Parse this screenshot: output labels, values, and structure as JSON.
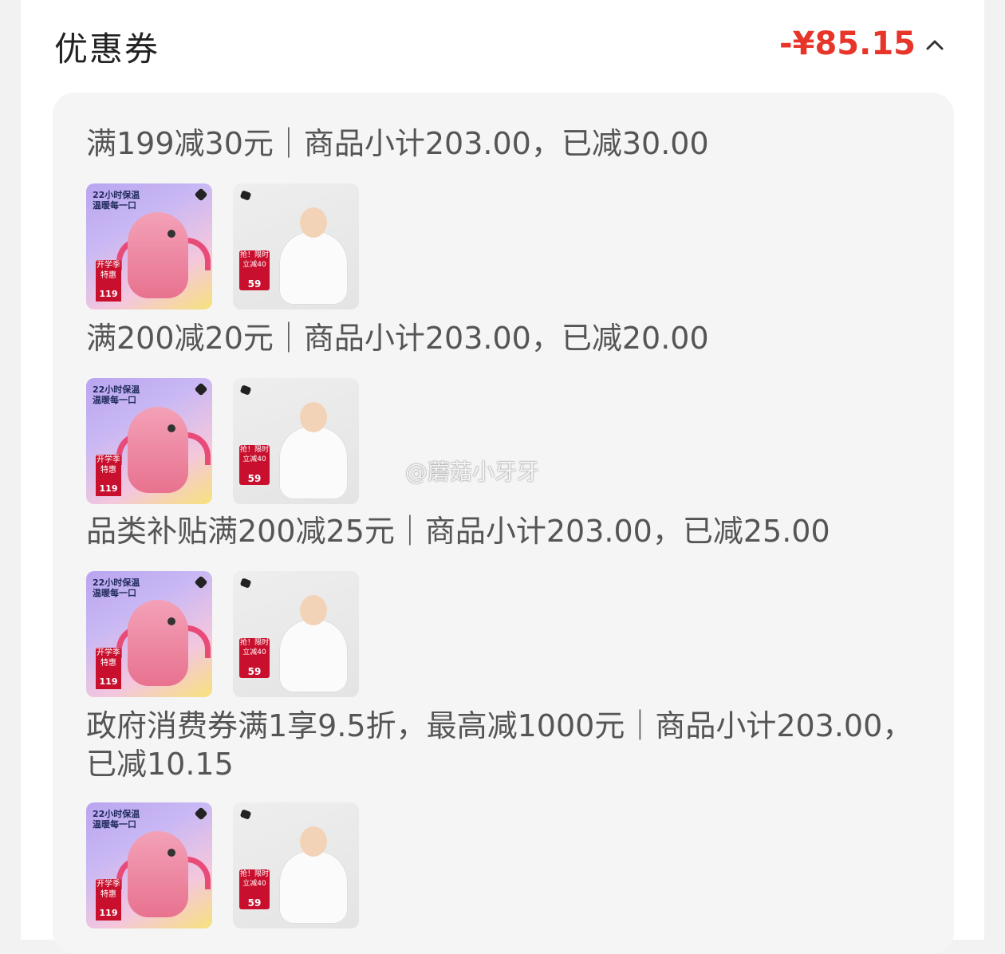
{
  "header": {
    "title": "优惠券",
    "discount_total": "-¥85.15",
    "collapse_icon": "chevron-up-icon"
  },
  "coupons": [
    {
      "rule": "满199减30元｜商品小计203.00，已减30.00",
      "products": [
        {
          "caption": "22小时保温\n温暖每一口",
          "badge": "开学季\n特惠",
          "price": "119"
        },
        {
          "badge": "抢！限时\n立减40",
          "price": "59"
        }
      ]
    },
    {
      "rule": "满200减20元｜商品小计203.00，已减20.00",
      "products": [
        {
          "caption": "22小时保温\n温暖每一口",
          "badge": "开学季\n特惠",
          "price": "119"
        },
        {
          "badge": "抢！限时\n立减40",
          "price": "59"
        }
      ]
    },
    {
      "rule": "品类补贴满200减25元｜商品小计203.00，已减25.00",
      "products": [
        {
          "caption": "22小时保温\n温暖每一口",
          "badge": "开学季\n特惠",
          "price": "119"
        },
        {
          "badge": "抢！限时\n立减40",
          "price": "59"
        }
      ]
    },
    {
      "rule": "政府消费券满1享9.5折，最高减1000元｜商品小计203.00，已减10.15",
      "products": [
        {
          "caption": "22小时保温\n温暖每一口",
          "badge": "开学季\n特惠",
          "price": "119"
        },
        {
          "badge": "抢！限时\n立减40",
          "price": "59"
        }
      ]
    }
  ],
  "watermark": "@蘑菇小牙牙",
  "colors": {
    "accent": "#e8352a",
    "badge": "#c8102e"
  }
}
